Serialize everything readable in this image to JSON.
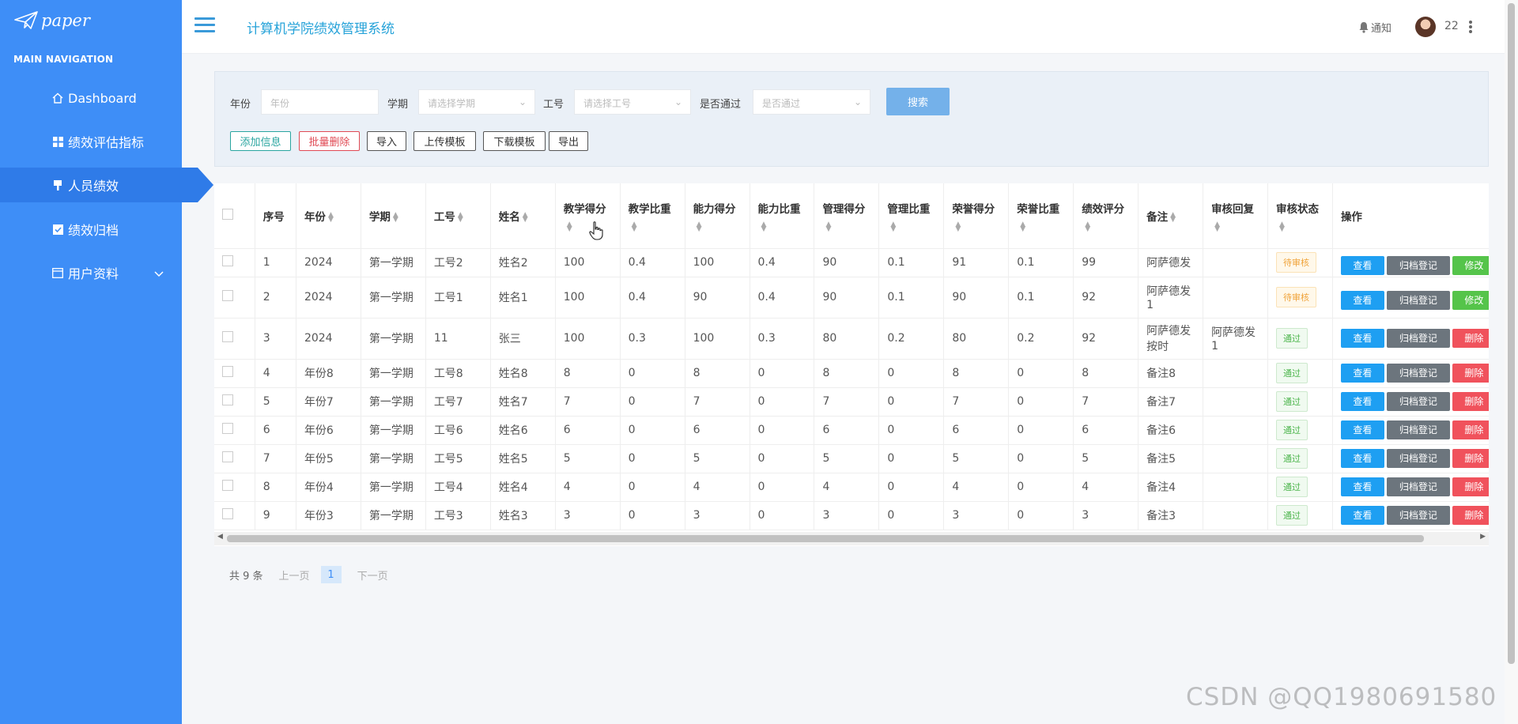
{
  "brand": {
    "logo_text": "paper"
  },
  "sidebar": {
    "header": "MAIN NAVIGATION",
    "items": [
      {
        "label": "Dashboard",
        "icon": "home-icon"
      },
      {
        "label": "绩效评估指标",
        "icon": "grid-icon"
      },
      {
        "label": "人员绩效",
        "icon": "flag-icon",
        "active": true
      },
      {
        "label": "绩效归档",
        "icon": "check-square-icon"
      },
      {
        "label": "用户资料",
        "icon": "calendar-icon",
        "expandable": true
      }
    ]
  },
  "header": {
    "title": "计算机学院绩效管理系统",
    "notification_label": "通知",
    "username": "22"
  },
  "filters": {
    "year_label": "年份",
    "year_placeholder": "年份",
    "term_label": "学期",
    "term_placeholder": "请选择学期",
    "id_label": "工号",
    "id_placeholder": "请选择工号",
    "pass_label": "是否通过",
    "pass_placeholder": "是否通过",
    "search_label": "搜索"
  },
  "actions": {
    "add": "添加信息",
    "batch_delete": "批量删除",
    "import": "导入",
    "upload_template": "上传模板",
    "download_template": "下载模板",
    "export": "导出"
  },
  "table": {
    "headers": {
      "index": "序号",
      "year": "年份",
      "term": "学期",
      "staff_id": "工号",
      "name": "姓名",
      "teaching_score": "教学得分",
      "teaching_weight": "教学比重",
      "ability_score": "能力得分",
      "ability_weight": "能力比重",
      "mgmt_score": "管理得分",
      "mgmt_weight": "管理比重",
      "honor_score": "荣誉得分",
      "honor_weight": "荣誉比重",
      "rating": "绩效评分",
      "remark": "备注",
      "review_reply": "审核回复",
      "review_status": "审核状态",
      "operations": "操作"
    },
    "buttons": {
      "view": "查看",
      "archive": "归档登记",
      "edit": "修改",
      "delete": "删除"
    },
    "rows": [
      [
        "1",
        "2024",
        "第一学期",
        "工号2",
        "姓名2",
        "100",
        "0.4",
        "100",
        "0.4",
        "90",
        "0.1",
        "91",
        "0.1",
        "99",
        "阿萨德发",
        "",
        "待审核"
      ],
      [
        "2",
        "2024",
        "第一学期",
        "工号1",
        "姓名1",
        "100",
        "0.4",
        "90",
        "0.4",
        "90",
        "0.1",
        "90",
        "0.1",
        "92",
        "阿萨德发1",
        "",
        "待审核"
      ],
      [
        "3",
        "2024",
        "第一学期",
        "11",
        "张三",
        "100",
        "0.3",
        "100",
        "0.3",
        "80",
        "0.2",
        "80",
        "0.2",
        "92",
        "阿萨德发按时",
        "阿萨德发1",
        "通过"
      ],
      [
        "4",
        "年份8",
        "第一学期",
        "工号8",
        "姓名8",
        "8",
        "0",
        "8",
        "0",
        "8",
        "0",
        "8",
        "0",
        "8",
        "备注8",
        "",
        "通过"
      ],
      [
        "5",
        "年份7",
        "第一学期",
        "工号7",
        "姓名7",
        "7",
        "0",
        "7",
        "0",
        "7",
        "0",
        "7",
        "0",
        "7",
        "备注7",
        "",
        "通过"
      ],
      [
        "6",
        "年份6",
        "第一学期",
        "工号6",
        "姓名6",
        "6",
        "0",
        "6",
        "0",
        "6",
        "0",
        "6",
        "0",
        "6",
        "备注6",
        "",
        "通过"
      ],
      [
        "7",
        "年份5",
        "第一学期",
        "工号5",
        "姓名5",
        "5",
        "0",
        "5",
        "0",
        "5",
        "0",
        "5",
        "0",
        "5",
        "备注5",
        "",
        "通过"
      ],
      [
        "8",
        "年份4",
        "第一学期",
        "工号4",
        "姓名4",
        "4",
        "0",
        "4",
        "0",
        "4",
        "0",
        "4",
        "0",
        "4",
        "备注4",
        "",
        "通过"
      ],
      [
        "9",
        "年份3",
        "第一学期",
        "工号3",
        "姓名3",
        "3",
        "0",
        "3",
        "0",
        "3",
        "0",
        "3",
        "0",
        "3",
        "备注3",
        "",
        "通过"
      ]
    ]
  },
  "pagination": {
    "total": "共 9 条",
    "prev": "上一页",
    "current": "1",
    "next": "下一页"
  },
  "watermark": "CSDN @QQ1980691580",
  "colors": {
    "sidebar": "#3e8ef7",
    "title": "#27a3d9",
    "view": "#1e9ff2",
    "archive": "#6c757d",
    "edit": "#55c44a",
    "delete": "#f0525c"
  }
}
